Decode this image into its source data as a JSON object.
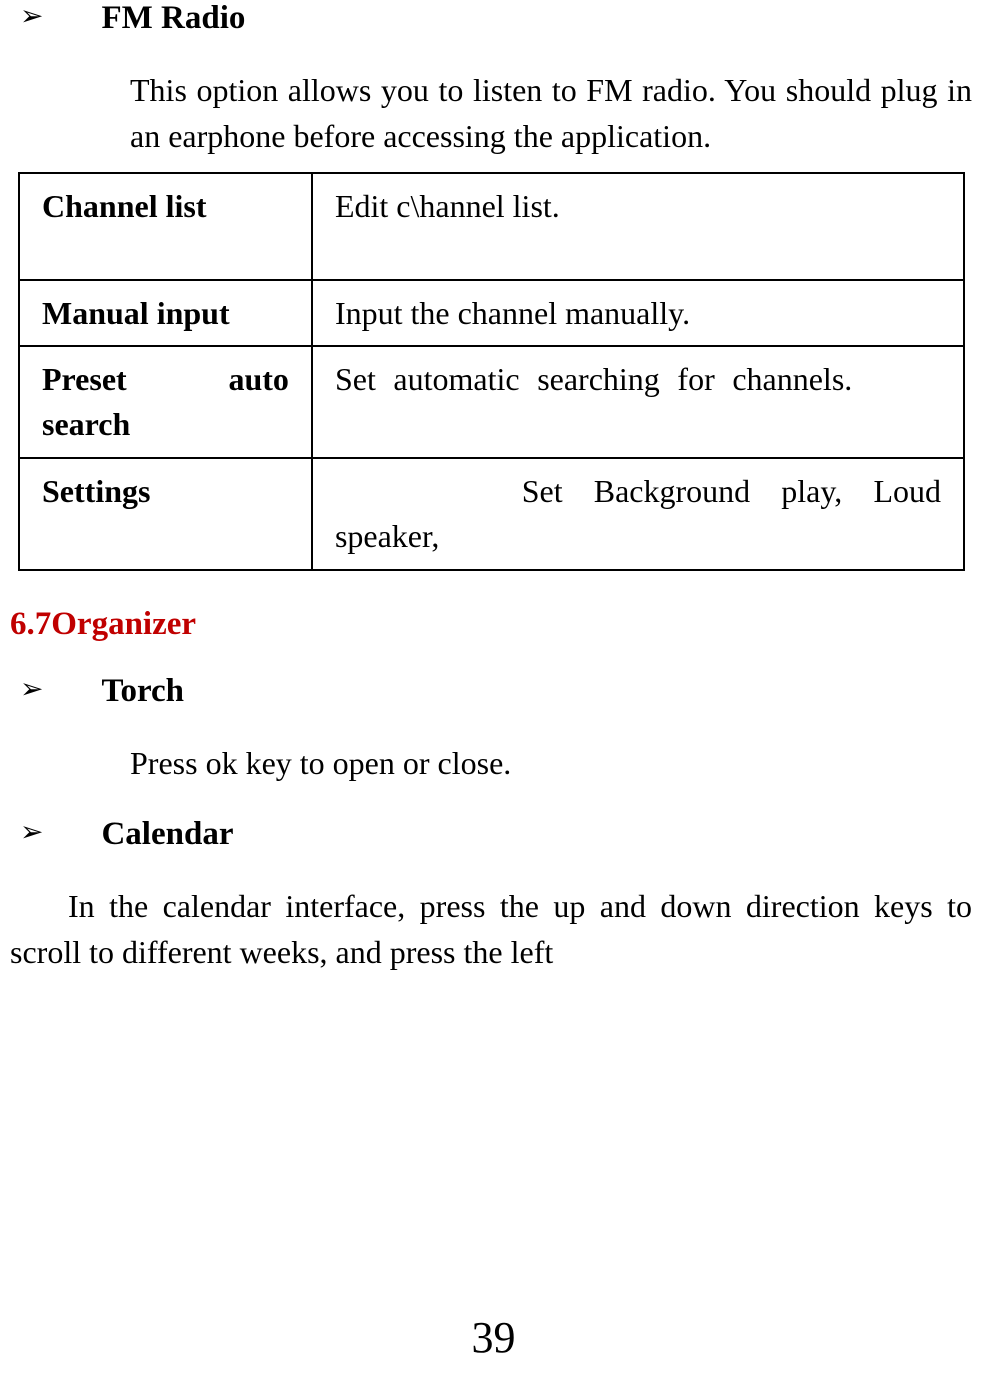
{
  "sections": {
    "fmRadio": {
      "title": "FM    Radio",
      "body": "This option allows you to listen to FM radio. You should plug in an earphone before accessing the application."
    },
    "torch": {
      "title": "Torch",
      "body": "Press ok key to open or close."
    },
    "calendar": {
      "title": "Calendar",
      "body": "In the calendar interface, press the up and down direction keys to scroll to different weeks, and press the left"
    }
  },
  "table": {
    "rows": [
      {
        "label": "Channel list",
        "desc": "Edit c\\hannel list."
      },
      {
        "label": "Manual input",
        "desc": "Input the channel manually."
      },
      {
        "label": "Preset auto search",
        "desc": "Set automatic searching for channels."
      },
      {
        "label": "Settings",
        "desc": "      Set Background play, Loud speaker,"
      }
    ]
  },
  "heading": {
    "organizer": "6.7Organizer"
  },
  "bullet": "➢",
  "pageNumber": "39"
}
